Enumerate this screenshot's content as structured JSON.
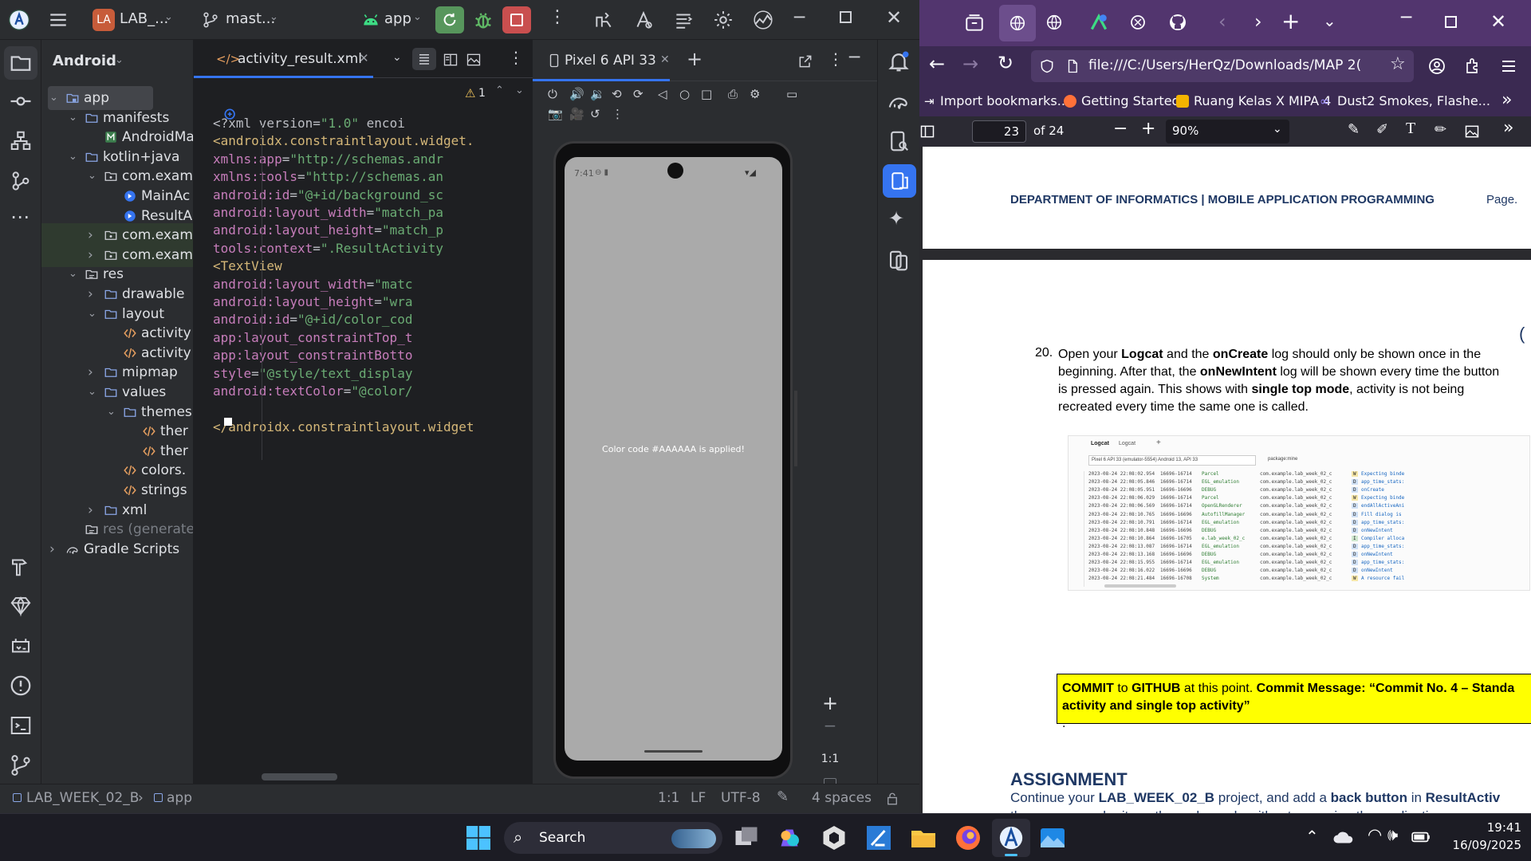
{
  "studio": {
    "project_badge": "LA",
    "project_name": "LAB_...",
    "branch": "mast...",
    "run_config": "app",
    "project_view_label": "Android",
    "editor_tab": "activity_result.xml",
    "warning_count": "1",
    "tree": [
      {
        "label": "app",
        "indent": 0,
        "arrow": "v",
        "icon": "module-folder-icon",
        "selected": true
      },
      {
        "label": "manifests",
        "indent": 1,
        "arrow": "v",
        "icon": "folder-icon"
      },
      {
        "label": "AndroidMa",
        "indent": 2,
        "arrow": "",
        "icon": "manifest-file-icon"
      },
      {
        "label": "kotlin+java",
        "indent": 1,
        "arrow": "v",
        "icon": "folder-icon"
      },
      {
        "label": "com.exam",
        "indent": 2,
        "arrow": "v",
        "icon": "package-icon"
      },
      {
        "label": "MainAc",
        "indent": 3,
        "arrow": "",
        "icon": "activity-class-icon"
      },
      {
        "label": "ResultA",
        "indent": 3,
        "arrow": "",
        "icon": "activity-class-icon"
      },
      {
        "label": "com.exam",
        "indent": 2,
        "arrow": ">",
        "icon": "package-icon",
        "highlight": true
      },
      {
        "label": "com.exam",
        "indent": 2,
        "arrow": ">",
        "icon": "package-icon",
        "highlight": true
      },
      {
        "label": "res",
        "indent": 1,
        "arrow": "v",
        "icon": "res-folder-icon"
      },
      {
        "label": "drawable",
        "indent": 2,
        "arrow": ">",
        "icon": "folder-icon"
      },
      {
        "label": "layout",
        "indent": 2,
        "arrow": "v",
        "icon": "folder-icon"
      },
      {
        "label": "activity",
        "indent": 3,
        "arrow": "",
        "icon": "xml-file-icon"
      },
      {
        "label": "activity",
        "indent": 3,
        "arrow": "",
        "icon": "xml-file-icon"
      },
      {
        "label": "mipmap",
        "indent": 2,
        "arrow": ">",
        "icon": "folder-icon"
      },
      {
        "label": "values",
        "indent": 2,
        "arrow": "v",
        "icon": "folder-icon"
      },
      {
        "label": "themes",
        "indent": 3,
        "arrow": "v",
        "icon": "folder-icon"
      },
      {
        "label": "ther",
        "indent": 4,
        "arrow": "",
        "icon": "xml-file-icon"
      },
      {
        "label": "ther",
        "indent": 4,
        "arrow": "",
        "icon": "xml-file-icon"
      },
      {
        "label": "colors.",
        "indent": 3,
        "arrow": "",
        "icon": "xml-file-icon"
      },
      {
        "label": "strings",
        "indent": 3,
        "arrow": "",
        "icon": "xml-file-icon"
      },
      {
        "label": "xml",
        "indent": 2,
        "arrow": ">",
        "icon": "folder-icon"
      },
      {
        "label": "res (generate",
        "indent": 1,
        "arrow": "",
        "icon": "res-folder-icon",
        "dim": true
      },
      {
        "label": "Gradle Scripts",
        "indent": 0,
        "arrow": ">",
        "icon": "gradle-icon"
      }
    ],
    "code_lines": [
      {
        "n": "1",
        "parts": [
          [
            "pl",
            "<?xml version="
          ],
          [
            "st",
            "\"1.0\""
          ],
          [
            "pl",
            " encoi"
          ]
        ]
      },
      {
        "n": "2",
        "parts": [
          [
            "tg",
            "<androidx.constraintlayout.widget."
          ]
        ]
      },
      {
        "n": "3",
        "parts": [
          [
            "pl",
            "    "
          ],
          [
            "at",
            "xmlns:app"
          ],
          [
            "pl",
            "="
          ],
          [
            "st",
            "\"http://schemas.andr"
          ]
        ]
      },
      {
        "n": "4",
        "parts": [
          [
            "pl",
            "    "
          ],
          [
            "at",
            "xmlns:tools"
          ],
          [
            "pl",
            "="
          ],
          [
            "st",
            "\"http://schemas.an"
          ]
        ]
      },
      {
        "n": "5",
        "parts": [
          [
            "pl",
            "    "
          ],
          [
            "at",
            "android:id"
          ],
          [
            "pl",
            "="
          ],
          [
            "st",
            "\"@+id/background_sc"
          ]
        ]
      },
      {
        "n": "6",
        "parts": [
          [
            "pl",
            "    "
          ],
          [
            "at",
            "android:layout_width"
          ],
          [
            "pl",
            "="
          ],
          [
            "st",
            "\"match_pa"
          ]
        ]
      },
      {
        "n": "7",
        "parts": [
          [
            "pl",
            "    "
          ],
          [
            "at",
            "android:layout_height"
          ],
          [
            "pl",
            "="
          ],
          [
            "st",
            "\"match_p"
          ]
        ]
      },
      {
        "n": "8",
        "parts": [
          [
            "pl",
            "    "
          ],
          [
            "at",
            "tools:context"
          ],
          [
            "pl",
            "="
          ],
          [
            "st",
            "\".ResultActivity"
          ]
        ]
      },
      {
        "n": "9",
        "parts": [
          [
            "pl",
            "    "
          ],
          [
            "tg",
            "<TextView"
          ]
        ]
      },
      {
        "n": "10",
        "parts": [
          [
            "pl",
            "        "
          ],
          [
            "at",
            "android:layout_width"
          ],
          [
            "pl",
            "="
          ],
          [
            "st",
            "\"matc"
          ]
        ]
      },
      {
        "n": "11",
        "parts": [
          [
            "pl",
            "        "
          ],
          [
            "at",
            "android:layout_height"
          ],
          [
            "pl",
            "="
          ],
          [
            "st",
            "\"wra"
          ]
        ]
      },
      {
        "n": "12",
        "parts": [
          [
            "pl",
            "        "
          ],
          [
            "at",
            "android:id"
          ],
          [
            "pl",
            "="
          ],
          [
            "st",
            "\"@+id/color_cod"
          ]
        ]
      },
      {
        "n": "13",
        "parts": [
          [
            "pl",
            "        "
          ],
          [
            "at",
            "app:layout_constraintTop_t"
          ]
        ]
      },
      {
        "n": "14",
        "parts": [
          [
            "pl",
            "        "
          ],
          [
            "at",
            "app:layout_constraintBotto"
          ]
        ]
      },
      {
        "n": "15",
        "parts": [
          [
            "pl",
            "        "
          ],
          [
            "at",
            "style"
          ],
          [
            "pl",
            "="
          ],
          [
            "st",
            "\"@style/text_display"
          ]
        ]
      },
      {
        "n": "16",
        "parts": [
          [
            "pl",
            "        "
          ],
          [
            "at",
            "android:textColor"
          ],
          [
            "pl",
            "="
          ],
          [
            "st",
            "\"@color/"
          ]
        ]
      },
      {
        "n": "17",
        "parts": []
      },
      {
        "n": "18",
        "parts": [
          [
            "tg",
            "</androidx.constraintlayout.widget"
          ]
        ]
      }
    ],
    "device_tab": "Pixel 6 API 33",
    "phone_time": "7:41",
    "phone_message": "Color code #AAAAAA is applied!",
    "phone_bg": "#AAAAAA",
    "zoom_ratio": "1:1",
    "breadcrumb_project": "LAB_WEEK_02_B",
    "breadcrumb_module": "app",
    "status_items": [
      "1:1",
      "LF",
      "UTF-8",
      "4 spaces"
    ]
  },
  "firefox": {
    "url": "file:///C:/Users/HerQz/Downloads/MAP 2(",
    "bookmarks": [
      "Import bookmarks...",
      "Getting Started",
      "Ruang Kelas X MIPA 4",
      "Dust2 Smokes, Flashe..."
    ],
    "page_number": "23",
    "page_total": "of 24",
    "zoom": "90%",
    "header_left": "DEPARTMENT OF INFORMATICS | MOBILE APPLICATION PROGRAMMING",
    "header_right": "Page.",
    "step_number": "20.",
    "step_segments": [
      [
        "n",
        "Open your "
      ],
      [
        "b",
        "Logcat"
      ],
      [
        "n",
        " and the "
      ],
      [
        "b",
        "onCreate"
      ],
      [
        "n",
        " log should only be shown once in the beginning. After that, the "
      ],
      [
        "b",
        "onNewIntent"
      ],
      [
        "n",
        " log will be shown every time the button is pressed again.  This shows with "
      ],
      [
        "b",
        "single top mode"
      ],
      [
        "n",
        ", activity is not being recreated every time the same one is called."
      ]
    ],
    "logcat_tab1": "Logcat",
    "logcat_tab2": "Logcat",
    "logcat_device": "Pixel 6 API 33 (emulator-5554) Android 13, API 33",
    "logcat_filter": "package:mine",
    "log_rows": [
      [
        "2023-08-24 22:08:02.954",
        "16696-16714",
        "Parcel",
        "com.example.lab_week_02_c",
        "W",
        "Expecting binde"
      ],
      [
        "2023-08-24 22:08:05.846",
        "16696-16714",
        "EGL_emulation",
        "com.example.lab_week_02_c",
        "D",
        "app_time_stats:"
      ],
      [
        "2023-08-24 22:08:05.951",
        "16696-16696",
        "DEBUG",
        "com.example.lab_week_02_c",
        "D",
        "onCreate"
      ],
      [
        "2023-08-24 22:08:06.029",
        "16696-16714",
        "Parcel",
        "com.example.lab_week_02_c",
        "W",
        "Expecting binde"
      ],
      [
        "2023-08-24 22:08:06.569",
        "16696-16714",
        "OpenGLRenderer",
        "com.example.lab_week_02_c",
        "D",
        "endAllActiveAni"
      ],
      [
        "2023-08-24 22:08:10.765",
        "16696-16696",
        "AutofillManager",
        "com.example.lab_week_02_c",
        "D",
        "Fill dialog is"
      ],
      [
        "2023-08-24 22:08:10.791",
        "16696-16714",
        "EGL_emulation",
        "com.example.lab_week_02_c",
        "D",
        "app_time_stats:"
      ],
      [
        "2023-08-24 22:08:10.848",
        "16696-16696",
        "DEBUG",
        "com.example.lab_week_02_c",
        "D",
        "onNewIntent"
      ],
      [
        "2023-08-24 22:08:10.864",
        "16696-16705",
        "e.lab_week_02_c",
        "com.example.lab_week_02_c",
        "I",
        "Compiler alloca"
      ],
      [
        "2023-08-24 22:08:13.087",
        "16696-16714",
        "EGL_emulation",
        "com.example.lab_week_02_c",
        "D",
        "app_time_stats:"
      ],
      [
        "2023-08-24 22:08:13.168",
        "16696-16696",
        "DEBUG",
        "com.example.lab_week_02_c",
        "D",
        "onNewIntent"
      ],
      [
        "2023-08-24 22:08:15.955",
        "16696-16714",
        "EGL_emulation",
        "com.example.lab_week_02_c",
        "D",
        "app_time_stats:"
      ],
      [
        "2023-08-24 22:08:16.022",
        "16696-16696",
        "DEBUG",
        "com.example.lab_week_02_c",
        "D",
        "onNewIntent"
      ],
      [
        "2023-08-24 22:08:21.484",
        "16696-16708",
        "System",
        "com.example.lab_week_02_c",
        "W",
        "A resource fail"
      ]
    ],
    "commit_segments": [
      [
        "b",
        "COMMIT"
      ],
      [
        "n",
        " to "
      ],
      [
        "b",
        "GITHUB"
      ],
      [
        "n",
        " at this point. "
      ],
      [
        "b",
        "Commit Message: “Commit No. 4 – Standa"
      ],
      [
        "b",
        "activity and single top activity”"
      ],
      [
        "n",
        "."
      ]
    ],
    "assignment_title": "ASSIGNMENT",
    "assignment_segments": [
      [
        "n",
        "Continue your "
      ],
      [
        "b",
        "LAB_WEEK_02_B"
      ],
      [
        "n",
        " project, and add a "
      ],
      [
        "b",
        "back button"
      ],
      [
        "n",
        " in "
      ],
      [
        "b",
        "ResultActiv"
      ],
      [
        "n",
        "the user can submit another color code without rerunning the application."
      ]
    ]
  },
  "taskbar": {
    "search_label": "Search",
    "time": "19:41",
    "date": "16/09/2025"
  },
  "colors": {
    "studio_bg": "#1e1f22",
    "studio_panel": "#2b2d30",
    "firefox_tabbar": "#52356e",
    "commit_box": "#ffff00",
    "pdf_header": "#1f3864"
  }
}
